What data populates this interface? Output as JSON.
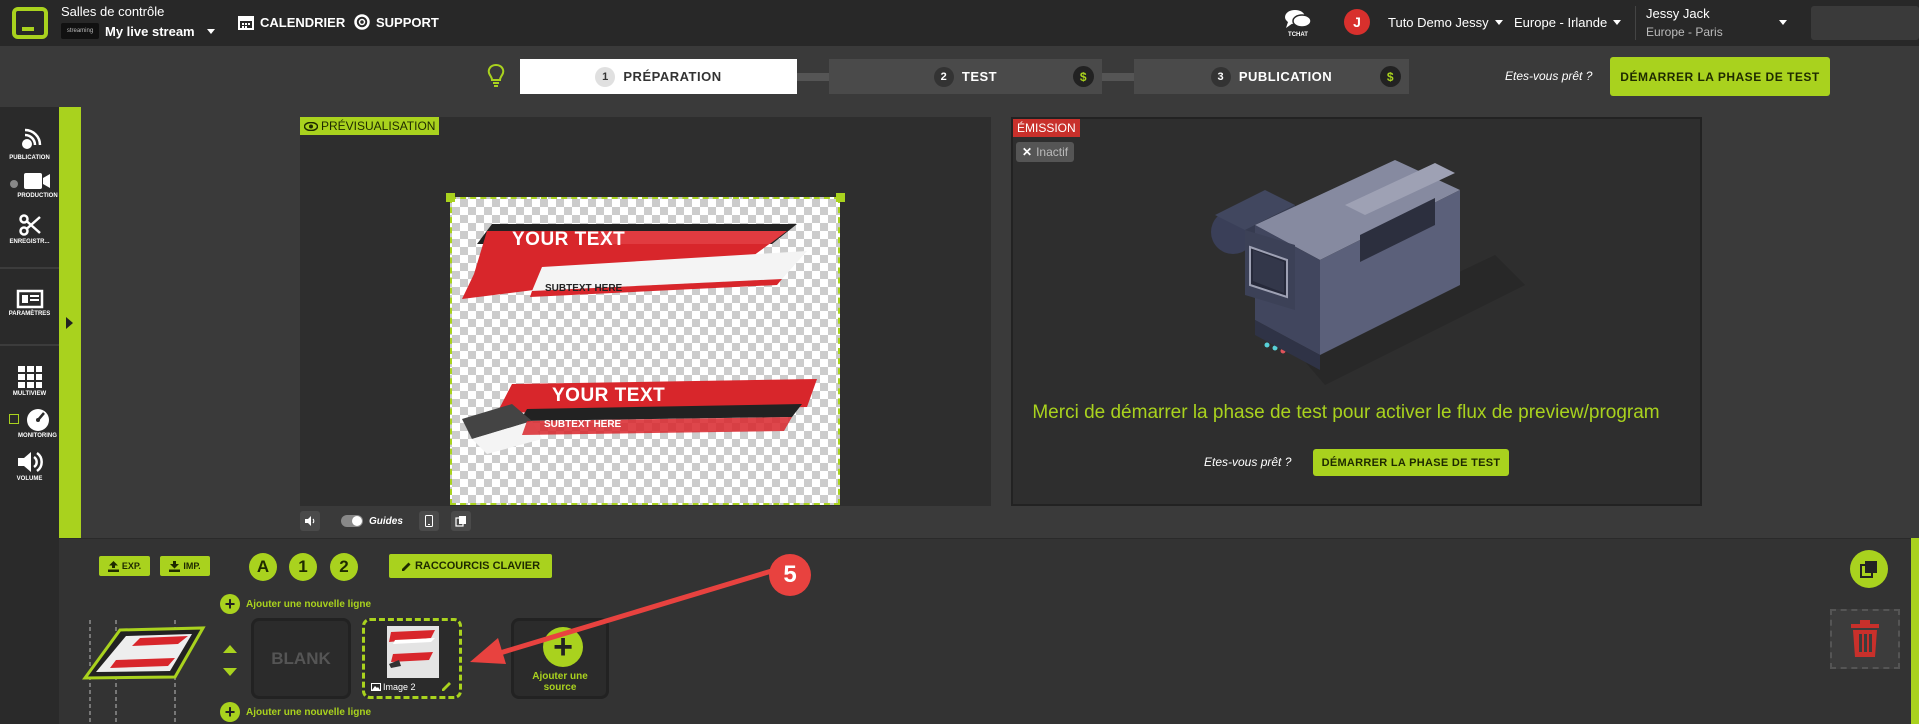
{
  "header": {
    "control_rooms": "Salles de contrôle",
    "stream_logo_text": "streaming",
    "stream_name": "My live stream",
    "nav": [
      {
        "label": "CALENDRIER",
        "icon": "calendar-icon"
      },
      {
        "label": "SUPPORT",
        "icon": "lifebuoy-icon"
      }
    ],
    "tchat": "TCHAT",
    "avatar_initial": "J",
    "workspace": "Tuto Demo Jessy",
    "region": "Europe - Irlande",
    "user_name": "Jessy Jack",
    "user_timezone": "Europe - Paris"
  },
  "steps": [
    {
      "num": "1",
      "label": "PRÉPARATION",
      "active": true
    },
    {
      "num": "2",
      "label": "TEST",
      "paid": "$"
    },
    {
      "num": "3",
      "label": "PUBLICATION",
      "paid": "$"
    }
  ],
  "ready_question": "Etes-vous prêt ?",
  "start_test_label": "DÉMARRER LA PHASE DE TEST",
  "sidebar": {
    "items": [
      {
        "label": "PUBLICATION",
        "icon": "broadcast-icon"
      },
      {
        "label": "PRODUCTION",
        "icon": "video-camera-icon"
      },
      {
        "label": "ENREGISTR...",
        "icon": "scissors-icon"
      },
      {
        "label": "PARAMÈTRES",
        "icon": "settings-panel-icon"
      },
      {
        "label": "MULTIVIEW",
        "icon": "grid-icon"
      },
      {
        "label": "MONITORING",
        "icon": "gauge-icon"
      },
      {
        "label": "VOLUME",
        "icon": "speaker-icon"
      }
    ]
  },
  "preview": {
    "tag": "PRÉVISUALISATION",
    "lower_third_1_title": "YOUR TEXT",
    "lower_third_1_sub": "SUBTEXT HERE",
    "lower_third_2_title": "YOUR TEXT",
    "lower_third_2_sub": "SUBTEXT HERE",
    "guides_label": "Guides"
  },
  "emission": {
    "tag": "ÉMISSION",
    "status": "Inactif",
    "message": "Merci de démarrer la phase de test pour activer le flux de preview/program"
  },
  "bottom": {
    "exp_label": "EXP.",
    "imp_label": "IMP.",
    "scenes": [
      "A",
      "1",
      "2"
    ],
    "shortcuts_label": "RACCOURCIS CLAVIER",
    "add_line_label": "Ajouter une nouvelle ligne",
    "blank_label": "BLANK",
    "image_label": "Image 2",
    "add_source_label_1": "Ajouter une",
    "add_source_label_2": "source"
  },
  "annotation": {
    "number": "5",
    "color": "#e8423f"
  },
  "colors": {
    "accent": "#a9d21e",
    "emission_tag": "#c8302b"
  }
}
